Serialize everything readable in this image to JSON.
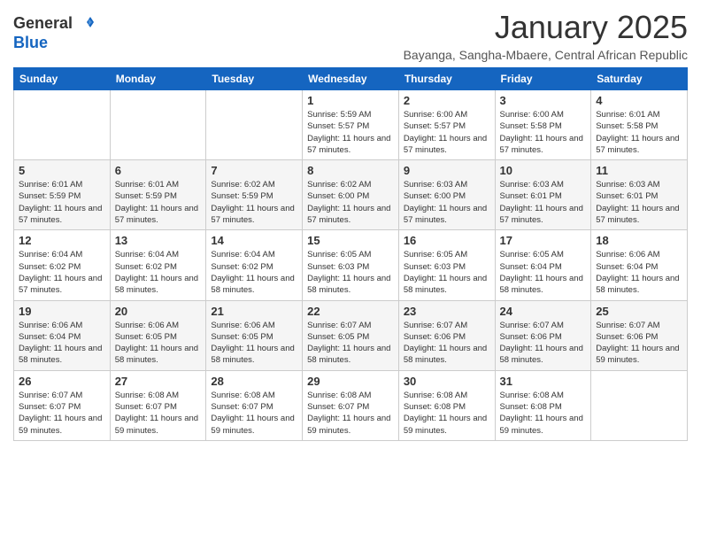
{
  "logo": {
    "general": "General",
    "blue": "Blue"
  },
  "header": {
    "month_year": "January 2025",
    "location": "Bayanga, Sangha-Mbaere, Central African Republic"
  },
  "weekdays": [
    "Sunday",
    "Monday",
    "Tuesday",
    "Wednesday",
    "Thursday",
    "Friday",
    "Saturday"
  ],
  "weeks": [
    [
      {
        "day": "",
        "info": ""
      },
      {
        "day": "",
        "info": ""
      },
      {
        "day": "",
        "info": ""
      },
      {
        "day": "1",
        "info": "Sunrise: 5:59 AM\nSunset: 5:57 PM\nDaylight: 11 hours and 57 minutes."
      },
      {
        "day": "2",
        "info": "Sunrise: 6:00 AM\nSunset: 5:57 PM\nDaylight: 11 hours and 57 minutes."
      },
      {
        "day": "3",
        "info": "Sunrise: 6:00 AM\nSunset: 5:58 PM\nDaylight: 11 hours and 57 minutes."
      },
      {
        "day": "4",
        "info": "Sunrise: 6:01 AM\nSunset: 5:58 PM\nDaylight: 11 hours and 57 minutes."
      }
    ],
    [
      {
        "day": "5",
        "info": "Sunrise: 6:01 AM\nSunset: 5:59 PM\nDaylight: 11 hours and 57 minutes."
      },
      {
        "day": "6",
        "info": "Sunrise: 6:01 AM\nSunset: 5:59 PM\nDaylight: 11 hours and 57 minutes."
      },
      {
        "day": "7",
        "info": "Sunrise: 6:02 AM\nSunset: 5:59 PM\nDaylight: 11 hours and 57 minutes."
      },
      {
        "day": "8",
        "info": "Sunrise: 6:02 AM\nSunset: 6:00 PM\nDaylight: 11 hours and 57 minutes."
      },
      {
        "day": "9",
        "info": "Sunrise: 6:03 AM\nSunset: 6:00 PM\nDaylight: 11 hours and 57 minutes."
      },
      {
        "day": "10",
        "info": "Sunrise: 6:03 AM\nSunset: 6:01 PM\nDaylight: 11 hours and 57 minutes."
      },
      {
        "day": "11",
        "info": "Sunrise: 6:03 AM\nSunset: 6:01 PM\nDaylight: 11 hours and 57 minutes."
      }
    ],
    [
      {
        "day": "12",
        "info": "Sunrise: 6:04 AM\nSunset: 6:02 PM\nDaylight: 11 hours and 57 minutes."
      },
      {
        "day": "13",
        "info": "Sunrise: 6:04 AM\nSunset: 6:02 PM\nDaylight: 11 hours and 58 minutes."
      },
      {
        "day": "14",
        "info": "Sunrise: 6:04 AM\nSunset: 6:02 PM\nDaylight: 11 hours and 58 minutes."
      },
      {
        "day": "15",
        "info": "Sunrise: 6:05 AM\nSunset: 6:03 PM\nDaylight: 11 hours and 58 minutes."
      },
      {
        "day": "16",
        "info": "Sunrise: 6:05 AM\nSunset: 6:03 PM\nDaylight: 11 hours and 58 minutes."
      },
      {
        "day": "17",
        "info": "Sunrise: 6:05 AM\nSunset: 6:04 PM\nDaylight: 11 hours and 58 minutes."
      },
      {
        "day": "18",
        "info": "Sunrise: 6:06 AM\nSunset: 6:04 PM\nDaylight: 11 hours and 58 minutes."
      }
    ],
    [
      {
        "day": "19",
        "info": "Sunrise: 6:06 AM\nSunset: 6:04 PM\nDaylight: 11 hours and 58 minutes."
      },
      {
        "day": "20",
        "info": "Sunrise: 6:06 AM\nSunset: 6:05 PM\nDaylight: 11 hours and 58 minutes."
      },
      {
        "day": "21",
        "info": "Sunrise: 6:06 AM\nSunset: 6:05 PM\nDaylight: 11 hours and 58 minutes."
      },
      {
        "day": "22",
        "info": "Sunrise: 6:07 AM\nSunset: 6:05 PM\nDaylight: 11 hours and 58 minutes."
      },
      {
        "day": "23",
        "info": "Sunrise: 6:07 AM\nSunset: 6:06 PM\nDaylight: 11 hours and 58 minutes."
      },
      {
        "day": "24",
        "info": "Sunrise: 6:07 AM\nSunset: 6:06 PM\nDaylight: 11 hours and 58 minutes."
      },
      {
        "day": "25",
        "info": "Sunrise: 6:07 AM\nSunset: 6:06 PM\nDaylight: 11 hours and 59 minutes."
      }
    ],
    [
      {
        "day": "26",
        "info": "Sunrise: 6:07 AM\nSunset: 6:07 PM\nDaylight: 11 hours and 59 minutes."
      },
      {
        "day": "27",
        "info": "Sunrise: 6:08 AM\nSunset: 6:07 PM\nDaylight: 11 hours and 59 minutes."
      },
      {
        "day": "28",
        "info": "Sunrise: 6:08 AM\nSunset: 6:07 PM\nDaylight: 11 hours and 59 minutes."
      },
      {
        "day": "29",
        "info": "Sunrise: 6:08 AM\nSunset: 6:07 PM\nDaylight: 11 hours and 59 minutes."
      },
      {
        "day": "30",
        "info": "Sunrise: 6:08 AM\nSunset: 6:08 PM\nDaylight: 11 hours and 59 minutes."
      },
      {
        "day": "31",
        "info": "Sunrise: 6:08 AM\nSunset: 6:08 PM\nDaylight: 11 hours and 59 minutes."
      },
      {
        "day": "",
        "info": ""
      }
    ]
  ]
}
